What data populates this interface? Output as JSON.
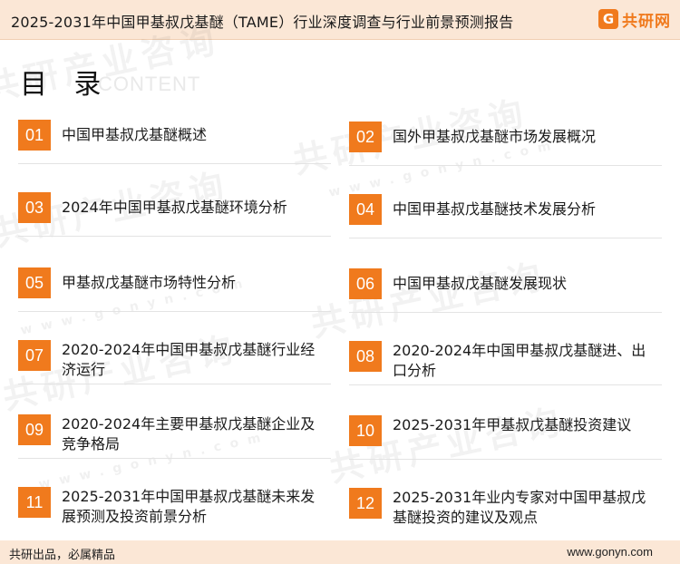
{
  "header": {
    "title": "2025-2031年中国甲基叔戊基醚（TAME）行业深度调查与行业前景预测报告",
    "logo_mark": "G",
    "logo_text": "共研网"
  },
  "toc": {
    "heading": "目 录",
    "subheading": "CONTENT"
  },
  "watermark": {
    "text": "共研产业咨询",
    "url_text": "www.gonyn.com"
  },
  "items": [
    {
      "num": "01",
      "label": "中国甲基叔戊基醚概述"
    },
    {
      "num": "02",
      "label": "国外甲基叔戊基醚市场发展概况"
    },
    {
      "num": "03",
      "label": "2024年中国甲基叔戊基醚环境分析"
    },
    {
      "num": "04",
      "label": "中国甲基叔戊基醚技术发展分析"
    },
    {
      "num": "05",
      "label": "甲基叔戊基醚市场特性分析"
    },
    {
      "num": "06",
      "label": "中国甲基叔戊基醚发展现状"
    },
    {
      "num": "07",
      "label": "2020-2024年中国甲基叔戊基醚行业经济运行"
    },
    {
      "num": "08",
      "label": "2020-2024年中国甲基叔戊基醚进、出口分析"
    },
    {
      "num": "09",
      "label": "2020-2024年主要甲基叔戊基醚企业及竞争格局"
    },
    {
      "num": "10",
      "label": "2025-2031年甲基叔戊基醚投资建议"
    },
    {
      "num": "11",
      "label": "2025-2031年中国甲基叔戊基醚未来发展预测及投资前景分析"
    },
    {
      "num": "12",
      "label": "2025-2031年业内专家对中国甲基叔戊基醚投资的建议及观点"
    }
  ],
  "footer": {
    "left": "共研出品，必属精品",
    "right": "www.gonyn.com"
  },
  "colors": {
    "accent": "#f07a1d",
    "band": "#fbe7d6"
  }
}
